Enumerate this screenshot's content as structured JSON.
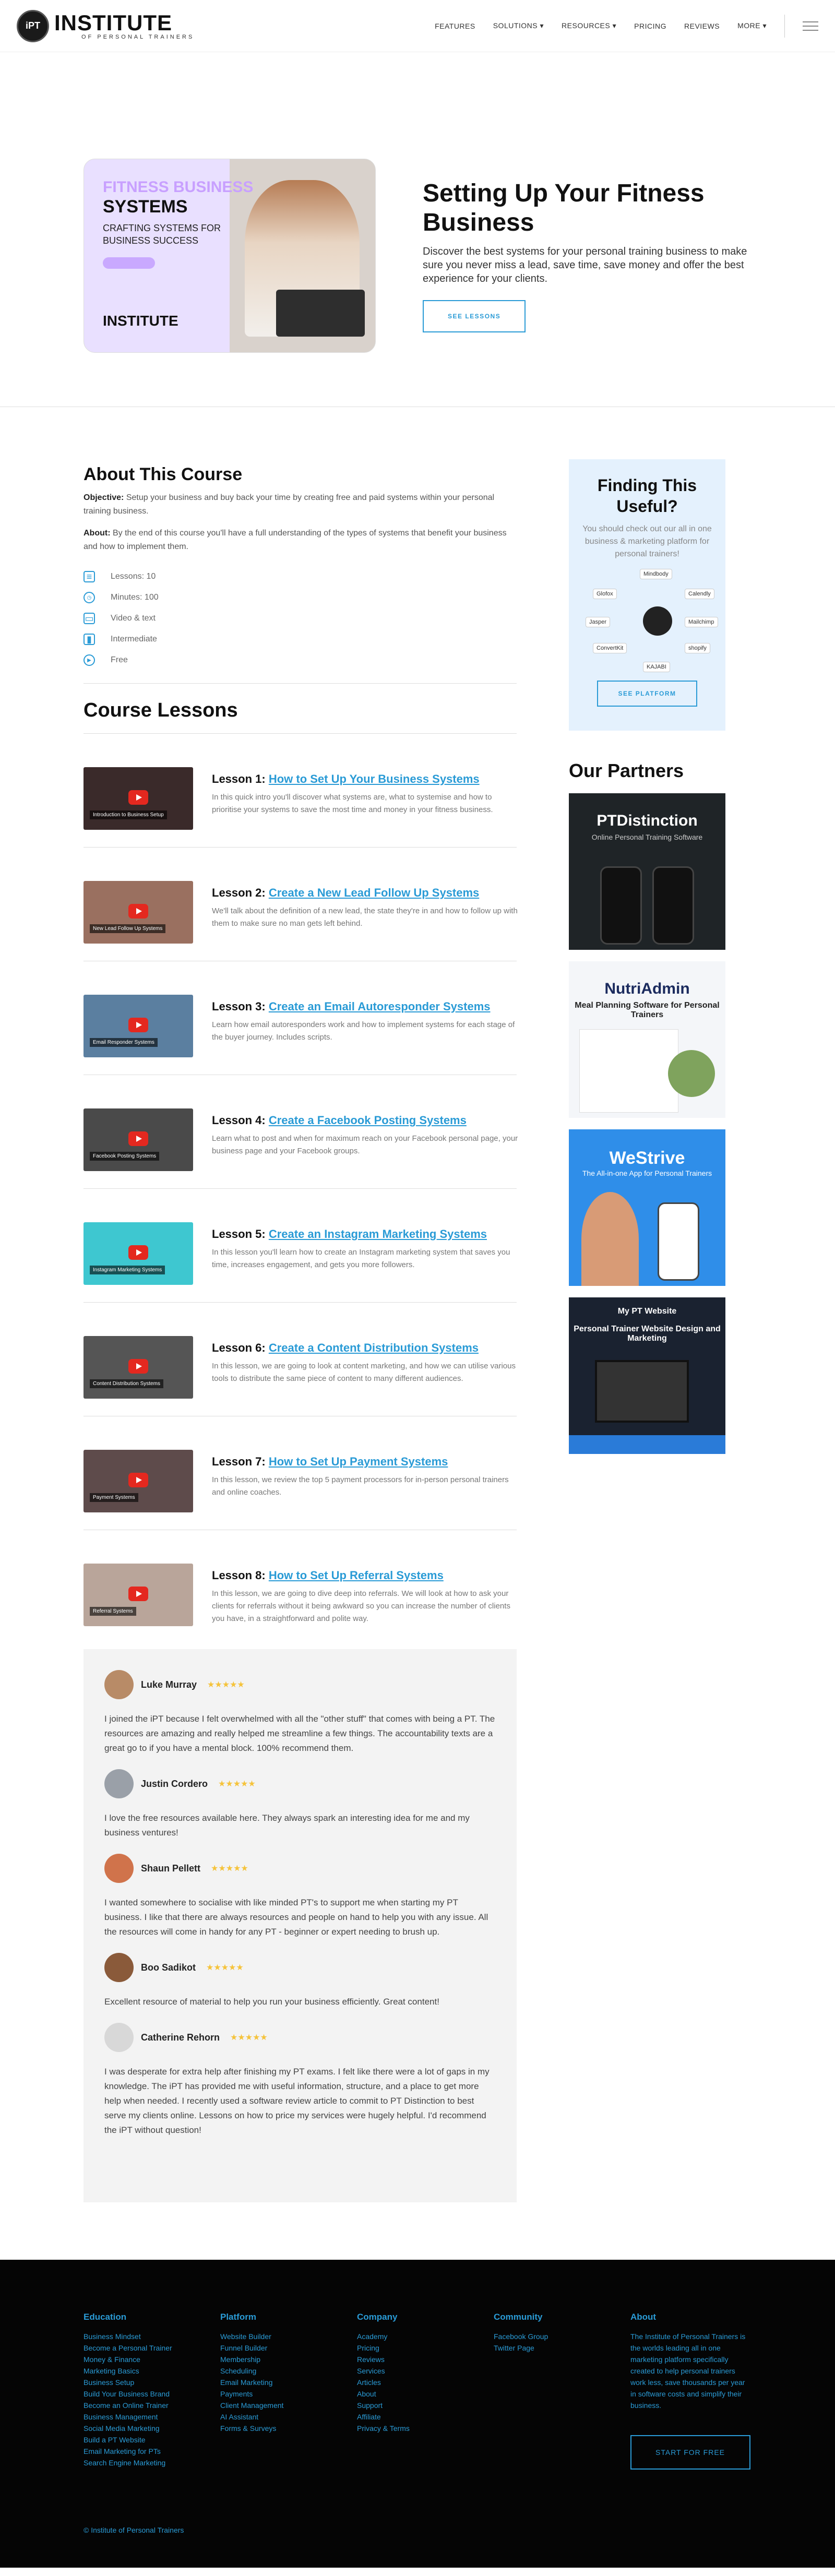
{
  "header": {
    "logo_mark": "iPT",
    "logo_big": "INSTITUTE",
    "logo_small": "OF PERSONAL TRAINERS",
    "nav": [
      "FEATURES",
      "SOLUTIONS ▾",
      "RESOURCES ▾",
      "PRICING",
      "REVIEWS",
      "MORE ▾"
    ]
  },
  "hero": {
    "image": {
      "tag": "FITNESS BUSINESS",
      "title": "SYSTEMS",
      "sub": "CRAFTING SYSTEMS FOR BUSINESS SUCCESS",
      "logo": "INSTITUTE"
    },
    "title": "Setting Up Your Fitness Business",
    "desc": "Discover the best systems for your personal training business to make sure you never miss a lead, save time, save money and offer the best experience for your clients.",
    "button": "SEE LESSONS"
  },
  "about": {
    "title": "About This Course",
    "objective_label": "Objective:",
    "objective": "Setup your business and buy back your time by creating free and paid systems within your personal training business.",
    "about_label": "About:",
    "about": "By the end of this course you'll have a full understanding of the types of systems that benefit your business and how to implement them.",
    "facts": [
      "Lessons: 10",
      "Minutes: 100",
      "Video & text",
      "Intermediate",
      "Free"
    ]
  },
  "lessons_title": "Course Lessons",
  "lessons": [
    {
      "num": "Lesson 1:",
      "link": "How to Set Up Your Business Systems",
      "desc": "In this quick intro you'll discover what systems are, what to systemise and how to prioritise your systems to save the most time and money in your fitness business.",
      "cap": "Introduction to Business Setup"
    },
    {
      "num": "Lesson 2:",
      "link": "Create a New Lead Follow Up Systems",
      "desc": "We'll talk about the definition of a new lead, the state they're in and how to follow up with them to make sure no man gets left behind.",
      "cap": "New Lead Follow Up Systems"
    },
    {
      "num": "Lesson 3:",
      "link": "Create an Email Autoresponder Systems",
      "desc": "Learn how email autoresponders work and how to implement systems for each stage of the buyer journey. Includes scripts.",
      "cap": "Email Responder Systems"
    },
    {
      "num": "Lesson 4:",
      "link": "Create a Facebook Posting Systems",
      "desc": "Learn what to post and when for maximum reach on your Facebook personal page, your business page and your Facebook groups.",
      "cap": "Facebook Posting Systems"
    },
    {
      "num": "Lesson 5:",
      "link": "Create an Instagram Marketing Systems",
      "desc": "In this lesson you'll learn how to create an Instagram marketing system that saves you time, increases engagement, and gets you more followers.",
      "cap": "Instagram Marketing Systems"
    },
    {
      "num": "Lesson 6:",
      "link": "Create a Content Distribution Systems",
      "desc": "In this lesson, we are going to look at content marketing, and how we can utilise various tools to distribute the same piece of content to many different audiences.",
      "cap": "Content Distribution Systems"
    },
    {
      "num": "Lesson 7:",
      "link": "How to Set Up Payment Systems",
      "desc": "In this lesson, we review the top 5 payment processors for in-person personal trainers and online coaches.",
      "cap": "Payment Systems"
    },
    {
      "num": "Lesson 8:",
      "link": "How to Set Up Referral Systems",
      "desc": "In this lesson, we are going to dive deep into referrals. We will look at how to ask your clients for referrals without it being awkward so you can increase the number of clients you have, in a straightforward and polite way.",
      "cap": "Referral Systems"
    }
  ],
  "reviews": [
    {
      "name": "Luke Murray",
      "stars": "★★★★★",
      "text": "I joined the iPT because I felt overwhelmed with all the \"other stuff\" that comes with being a PT. The resources are amazing and really helped me streamline a few things. The accountability texts are a great go to if you have a mental block. 100% recommend them."
    },
    {
      "name": "Justin Cordero",
      "stars": "★★★★★",
      "text": "I love the free resources available here. They always spark an interesting idea for me and my business ventures!"
    },
    {
      "name": "Shaun Pellett",
      "stars": "★★★★★",
      "text": "I wanted somewhere to socialise with like minded PT's to support me when starting my PT business. I like that there are always resources and people on hand to help you with any issue. All the resources will come in handy for any PT - beginner or expert needing to brush up."
    },
    {
      "name": "Boo Sadikot",
      "stars": "★★★★★",
      "text": "Excellent resource of material to help you run your business efficiently. Great content!"
    },
    {
      "name": "Catherine Rehorn",
      "stars": "★★★★★",
      "text": "I was desperate for extra help after finishing my PT exams. I felt like there were a lot of gaps in my knowledge. The iPT has provided me with useful information, structure, and a place to get more help when needed. I recently used a software review article to commit to PT Distinction to best serve my clients online. Lessons on how to price my services were hugely helpful. I'd recommend the iPT without question!"
    }
  ],
  "sidebar": {
    "finding_title": "Finding This Useful?",
    "finding_text": "You should check out our all in one business & marketing platform for personal trainers!",
    "hub": [
      "Mindbody",
      "Glofox",
      "Calendly",
      "Jasper",
      "Mailchimp",
      "ConvertKit",
      "shopify",
      "KAJABI"
    ],
    "finding_button": "SEE PLATFORM",
    "partners_title": "Our Partners",
    "partners": [
      {
        "title": "PTDistinction",
        "sub": "Online Personal Training Software"
      },
      {
        "title": "NutriAdmin",
        "sub": "Meal Planning Software for Personal Trainers"
      },
      {
        "title": "WeStrive",
        "sub": "The All-in-one App for Personal Trainers"
      },
      {
        "title": "My PT Website",
        "sub": "Personal Trainer Website Design and Marketing"
      }
    ]
  },
  "footer": {
    "cols": [
      {
        "title": "Education",
        "links": [
          "Business Mindset",
          "Become a Personal Trainer",
          "Money & Finance",
          "Marketing Basics",
          "Business Setup",
          "Build Your Business Brand",
          "Become an Online Trainer",
          "Business Management",
          "Social Media Marketing",
          "Build a PT Website",
          "Email Marketing for PTs",
          "Search Engine Marketing"
        ]
      },
      {
        "title": "Platform",
        "links": [
          "Website Builder",
          "Funnel Builder",
          "Membership",
          "Scheduling",
          "Email Marketing",
          "Payments",
          "Client Management",
          "AI Assistant",
          "Forms & Surveys"
        ]
      },
      {
        "title": "Company",
        "links": [
          "Academy",
          "Pricing",
          "Reviews",
          "Services",
          "Articles",
          "About",
          "Support",
          "Affiliate",
          "Privacy & Terms"
        ]
      },
      {
        "title": "Community",
        "links": [
          "Facebook Group",
          "Twitter Page"
        ]
      }
    ],
    "about_title": "About",
    "about_text": "The Institute of Personal Trainers is the worlds leading all in one marketing platform specifically created to help personal trainers work less, save thousands per year in software costs and simplify their business.",
    "button": "START FOR FREE",
    "copyright": "© Institute of Personal Trainers"
  },
  "colors": {
    "accent": "#2a9bd6",
    "footer_bg": "#050505",
    "review_bg": "#f3f3f3",
    "sidebar_card": "#e4f1fd"
  }
}
